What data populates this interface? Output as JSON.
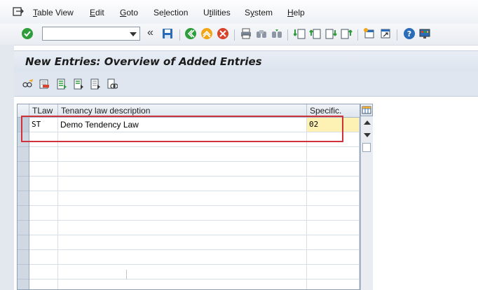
{
  "menubar": {
    "items": [
      {
        "label": "Table View",
        "underline": "T"
      },
      {
        "label": "Edit",
        "underline": "E"
      },
      {
        "label": "Goto",
        "underline": "G"
      },
      {
        "label": "Selection",
        "underline": "l"
      },
      {
        "label": "Utilities",
        "underline": "t"
      },
      {
        "label": "System",
        "underline": "y"
      },
      {
        "label": "Help",
        "underline": "H"
      }
    ]
  },
  "toolbar": {
    "command_value": "",
    "icons": [
      "enter-icon",
      "save-icon",
      "back-icon",
      "exit-icon",
      "cancel-icon",
      "print-icon",
      "find-icon",
      "find-next-icon",
      "first-page-icon",
      "previous-page-icon",
      "next-page-icon",
      "last-page-icon",
      "create-session-icon",
      "shortcut-icon",
      "help-icon",
      "layout-icon"
    ],
    "colors": {
      "green": "#2e9e3a",
      "yellow": "#f2a516",
      "red": "#d8432b",
      "blue": "#2a6cb8"
    }
  },
  "page": {
    "title": "New Entries: Overview of Added Entries"
  },
  "app_toolbar": {
    "icons": [
      "change-display-icon",
      "delete-icon",
      "select-all-icon",
      "select-block-icon",
      "deselect-all-icon",
      "variable-list-icon"
    ]
  },
  "table": {
    "columns": [
      "TLaw",
      "Tenancy law description",
      "Specific."
    ],
    "rows": [
      {
        "tlaw": "ST",
        "description": "Demo Tendency Law",
        "specific": "02"
      }
    ],
    "empty_row_count": 11,
    "highlight_color": "#d0323c",
    "edit_field_color": "#fdf2b3"
  }
}
